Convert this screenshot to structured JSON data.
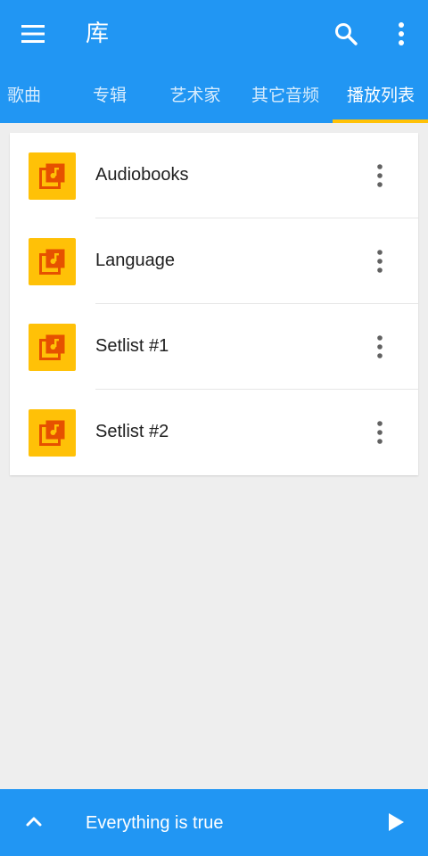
{
  "app_bar": {
    "title": "库"
  },
  "tabs": [
    {
      "label": "歌曲"
    },
    {
      "label": "专辑"
    },
    {
      "label": "艺术家"
    },
    {
      "label": "其它音频"
    },
    {
      "label": "播放列表",
      "active": true
    }
  ],
  "playlists": [
    {
      "name": "Audiobooks",
      "icon": "playlist-icon"
    },
    {
      "name": "Language",
      "icon": "playlist-icon"
    },
    {
      "name": "Setlist #1",
      "icon": "playlist-icon"
    },
    {
      "name": "Setlist #2",
      "icon": "playlist-icon"
    }
  ],
  "now_playing": {
    "title": "Everything is true"
  },
  "colors": {
    "primary": "#2196f3",
    "accent": "#ffc107",
    "icon_fg": "#e65100"
  }
}
